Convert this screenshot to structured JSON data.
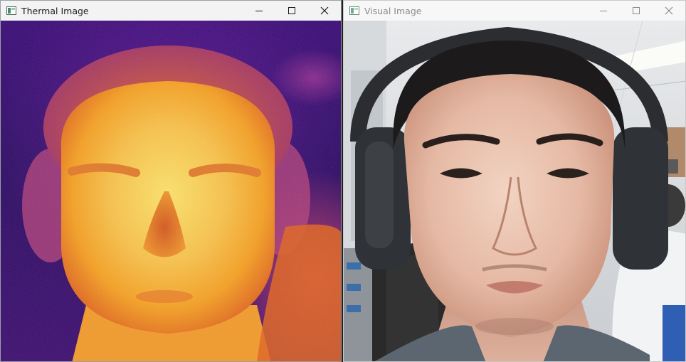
{
  "thermal_window": {
    "title": "Thermal Image",
    "app_icon": "opencv-window-icon",
    "controls": {
      "minimize": "minimize-icon",
      "maximize": "maximize-icon",
      "close": "close-icon"
    },
    "image_content": "thermal-face"
  },
  "visual_window": {
    "title": "Visual Image",
    "app_icon": "opencv-window-icon",
    "controls": {
      "minimize": "minimize-icon",
      "maximize": "maximize-icon",
      "close": "close-icon"
    },
    "image_content": "webcam-face"
  },
  "colors": {
    "thermal_hot": "#fde36a",
    "thermal_warm": "#f6a022",
    "thermal_mid": "#e0641e",
    "thermal_cool": "#8a2a8e",
    "thermal_cold": "#2a0a62",
    "titlebar_active": "#f3f3f3",
    "titlebar_inactive": "#f7f7f7"
  }
}
